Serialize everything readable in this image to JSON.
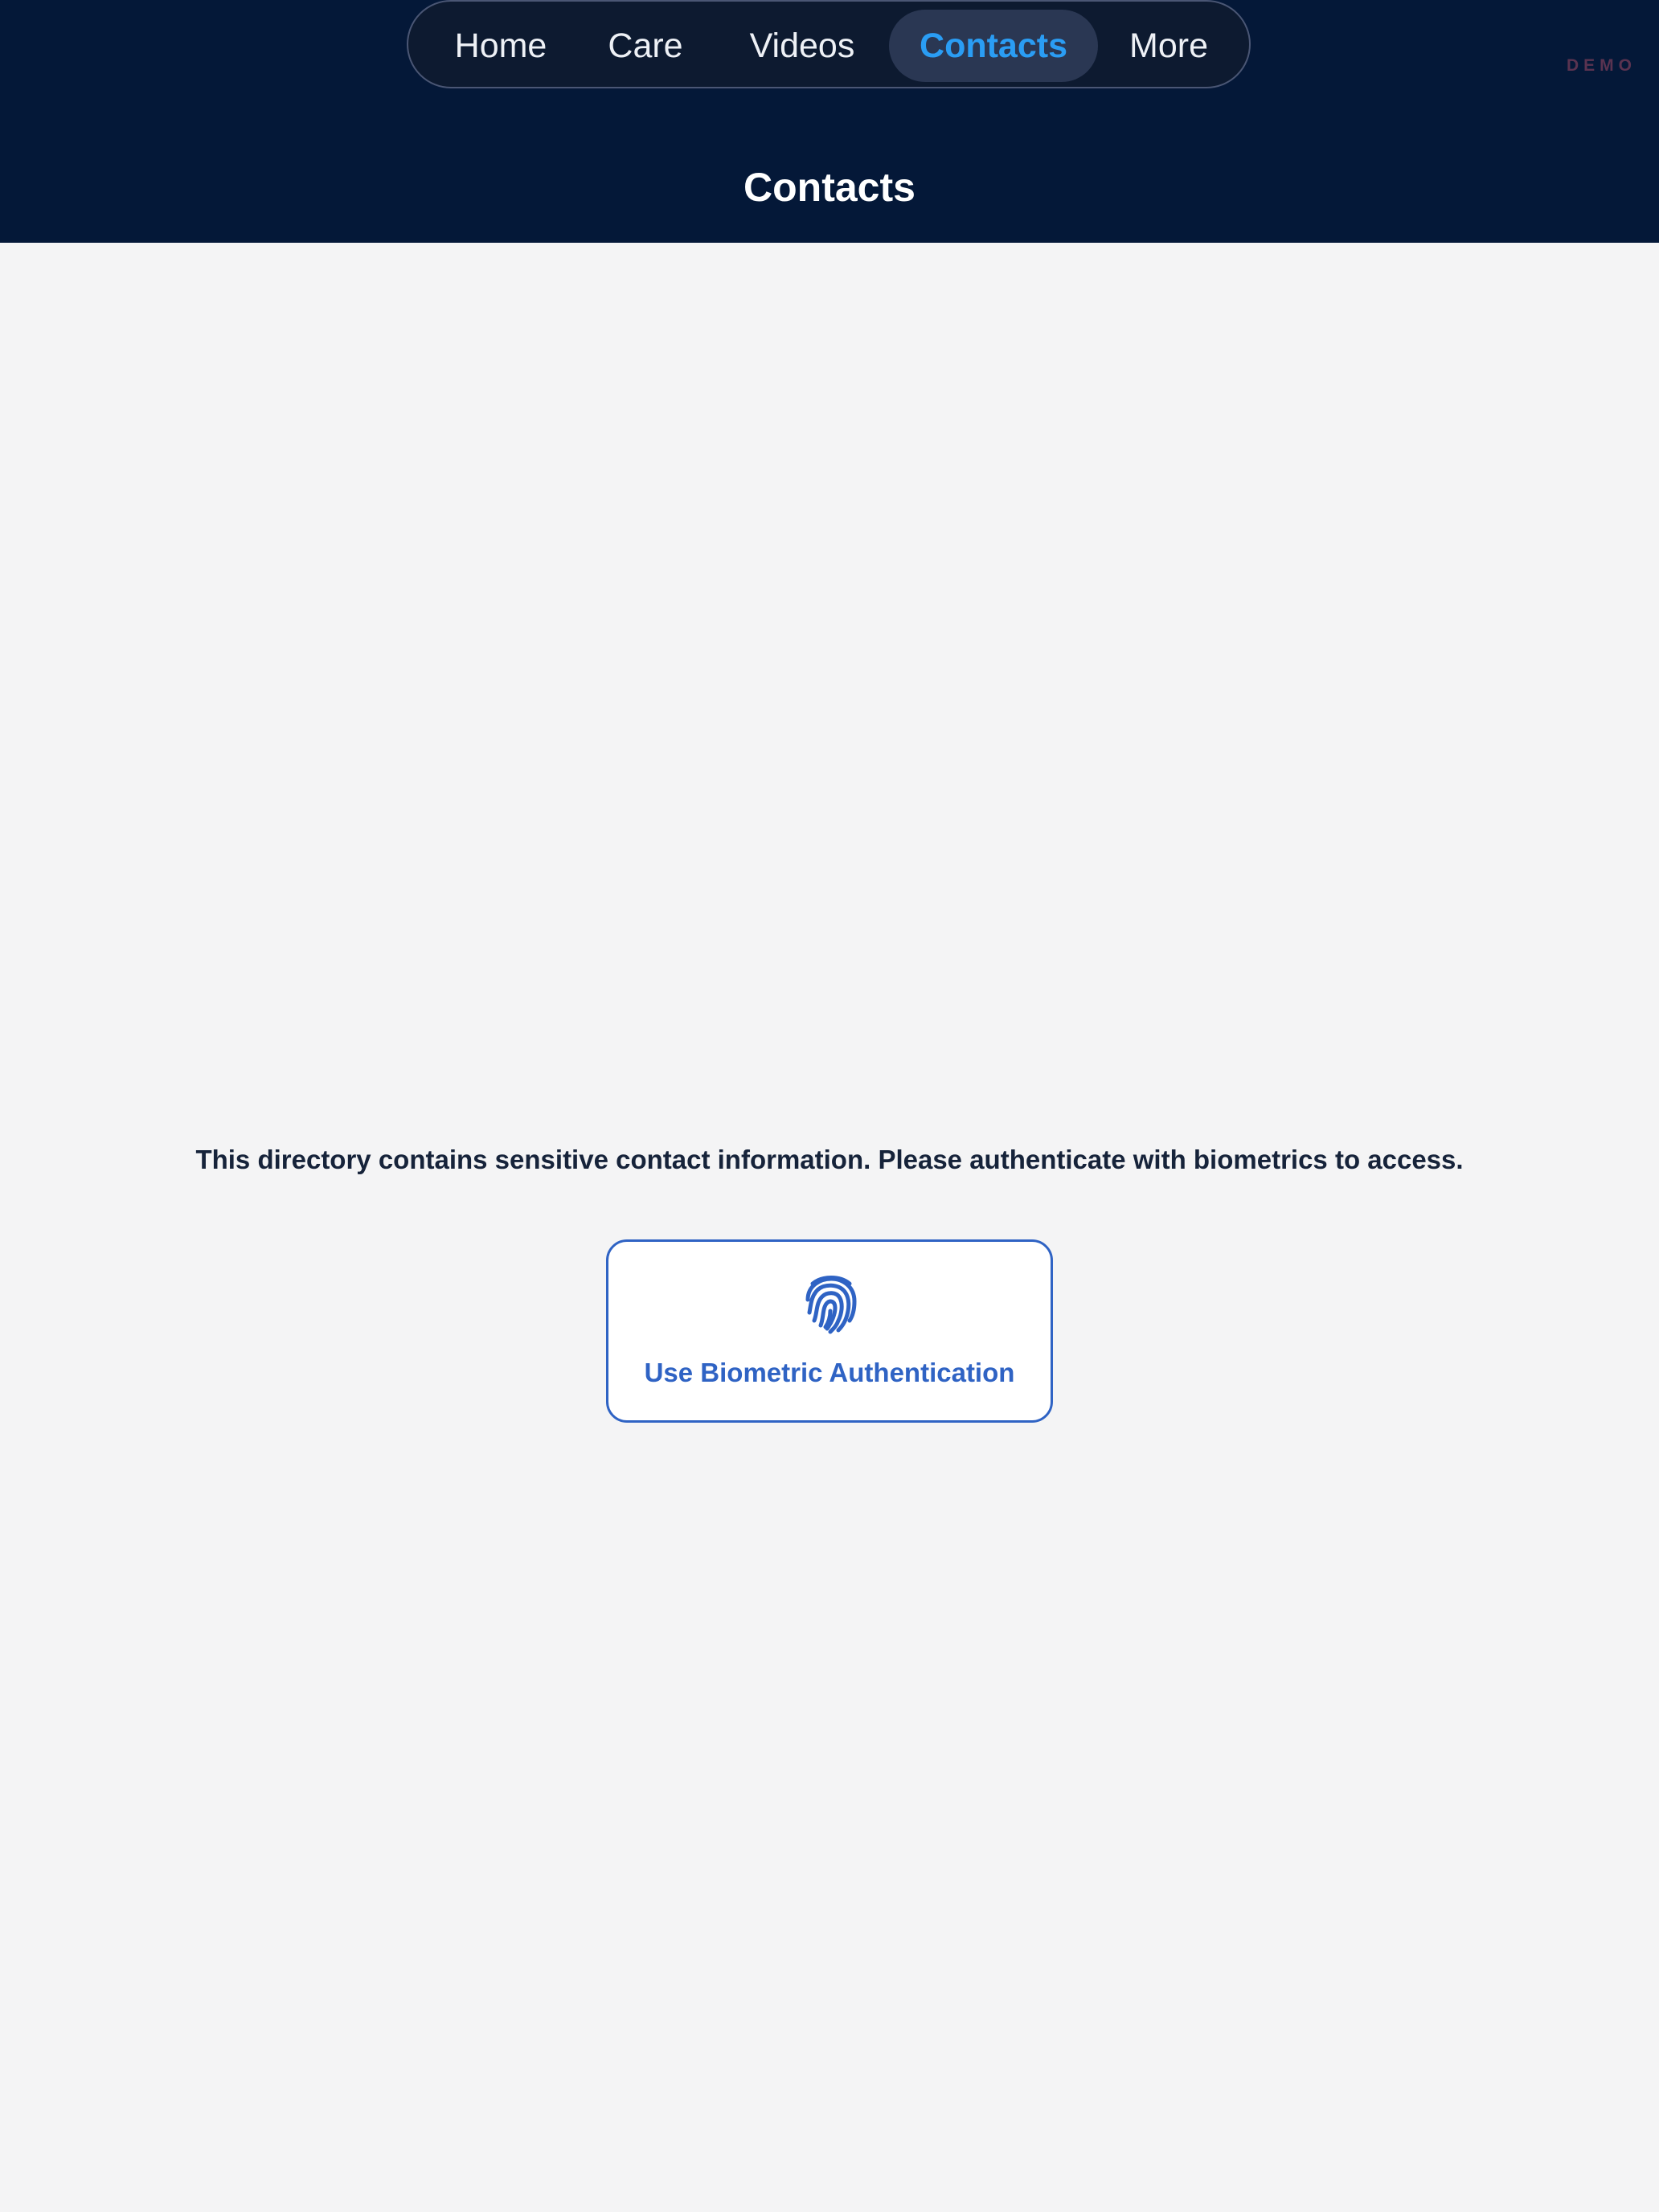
{
  "nav": {
    "tabs": [
      {
        "label": "Home",
        "active": false
      },
      {
        "label": "Care",
        "active": false
      },
      {
        "label": "Videos",
        "active": false
      },
      {
        "label": "Contacts",
        "active": true
      },
      {
        "label": "More",
        "active": false
      }
    ]
  },
  "badge": {
    "text": "DEMO"
  },
  "header": {
    "title": "Contacts"
  },
  "main": {
    "message": "This directory contains sensitive contact information. Please authenticate with biometrics to access.",
    "auth_button": {
      "label": "Use Biometric Authentication",
      "icon": "fingerprint-icon"
    }
  },
  "colors": {
    "header_bg": "#041838",
    "page_bg": "#f4f4f5",
    "active_tab_text": "#2a9df4",
    "accent": "#2f63c4"
  }
}
